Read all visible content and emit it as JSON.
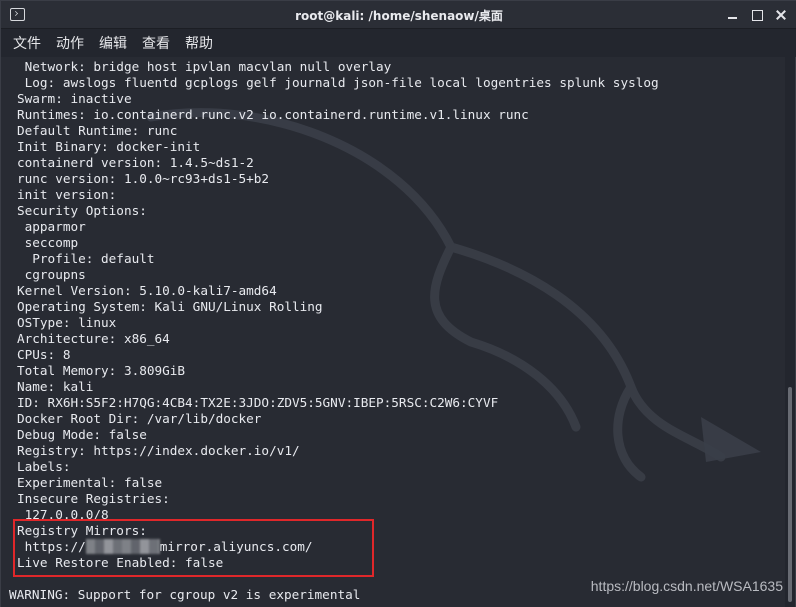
{
  "window": {
    "title": "root@kali: /home/shenaow/桌面"
  },
  "menu": {
    "items": [
      "文件",
      "动作",
      "编辑",
      "查看",
      "帮助"
    ]
  },
  "terminal": {
    "lines": [
      " Network: bridge host ipvlan macvlan null overlay",
      " Log: awslogs fluentd gcplogs gelf journald json-file local logentries splunk syslog",
      "Swarm: inactive",
      "Runtimes: io.containerd.runc.v2 io.containerd.runtime.v1.linux runc",
      "Default Runtime: runc",
      "Init Binary: docker-init",
      "containerd version: 1.4.5~ds1-2",
      "runc version: 1.0.0~rc93+ds1-5+b2",
      "init version:",
      "Security Options:",
      " apparmor",
      " seccomp",
      "  Profile: default",
      " cgroupns",
      "Kernel Version: 5.10.0-kali7-amd64",
      "Operating System: Kali GNU/Linux Rolling",
      "OSType: linux",
      "Architecture: x86_64",
      "CPUs: 8",
      "Total Memory: 3.809GiB",
      "Name: kali",
      "ID: RX6H:S5F2:H7QG:4CB4:TX2E:3JDO:ZDV5:5GNV:IBEP:5RSC:C2W6:CYVF",
      "Docker Root Dir: /var/lib/docker",
      "Debug Mode: false",
      "Registry: https://index.docker.io/v1/",
      "Labels:",
      "Experimental: false",
      "Insecure Registries:",
      " 127.0.0.0/8",
      "Registry Mirrors:"
    ],
    "mirror_prefix": " https://",
    "mirror_suffix": "mirror.aliyuncs.com/",
    "live_restore": "Live Restore Enabled: false",
    "warning": "WARNING: Support for cgroup v2 is experimental"
  },
  "watermark": "https://blog.csdn.net/WSA1635",
  "colors": {
    "background": "#282b33",
    "text": "#e8eaef",
    "highlight_border": "#e0272a"
  },
  "icons": [
    "terminal-icon",
    "minimize-icon",
    "maximize-icon",
    "close-icon"
  ]
}
